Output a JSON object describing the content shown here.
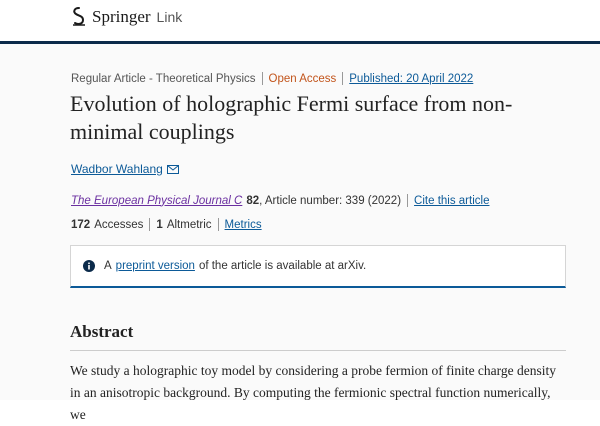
{
  "header": {
    "brand_word": "Springer",
    "brand_suffix": "Link"
  },
  "article": {
    "type_label": "Regular Article - Theoretical Physics",
    "open_access": "Open Access",
    "published": "Published: 20 April 2022",
    "title": "Evolution of holographic Fermi surface from non-minimal couplings",
    "author": "Wadbor Wahlang",
    "journal": "The European Physical Journal C",
    "volume": "82",
    "article_info": ", Article number: 339 (2022)",
    "cite_label": "Cite this article",
    "accesses_count": "172",
    "accesses_label": "Accesses",
    "altmetric_count": "1",
    "altmetric_label": "Altmetric",
    "metrics_label": "Metrics"
  },
  "notice": {
    "prefix": "A",
    "link": "preprint version",
    "suffix": "of the article is available at arXiv."
  },
  "abstract": {
    "heading": "Abstract",
    "text": "We study a holographic toy model by considering a probe fermion of finite charge density in an anisotropic background. By computing the fermionic spectral function numerically, we"
  },
  "colors": {
    "navy": "#0b2a4a",
    "link_blue": "#0c5a98",
    "open_access_orange": "#c2541b",
    "journal_purple": "#6a2fa0"
  },
  "icons": [
    "springer-logo-icon",
    "mail-icon",
    "info-icon"
  ]
}
